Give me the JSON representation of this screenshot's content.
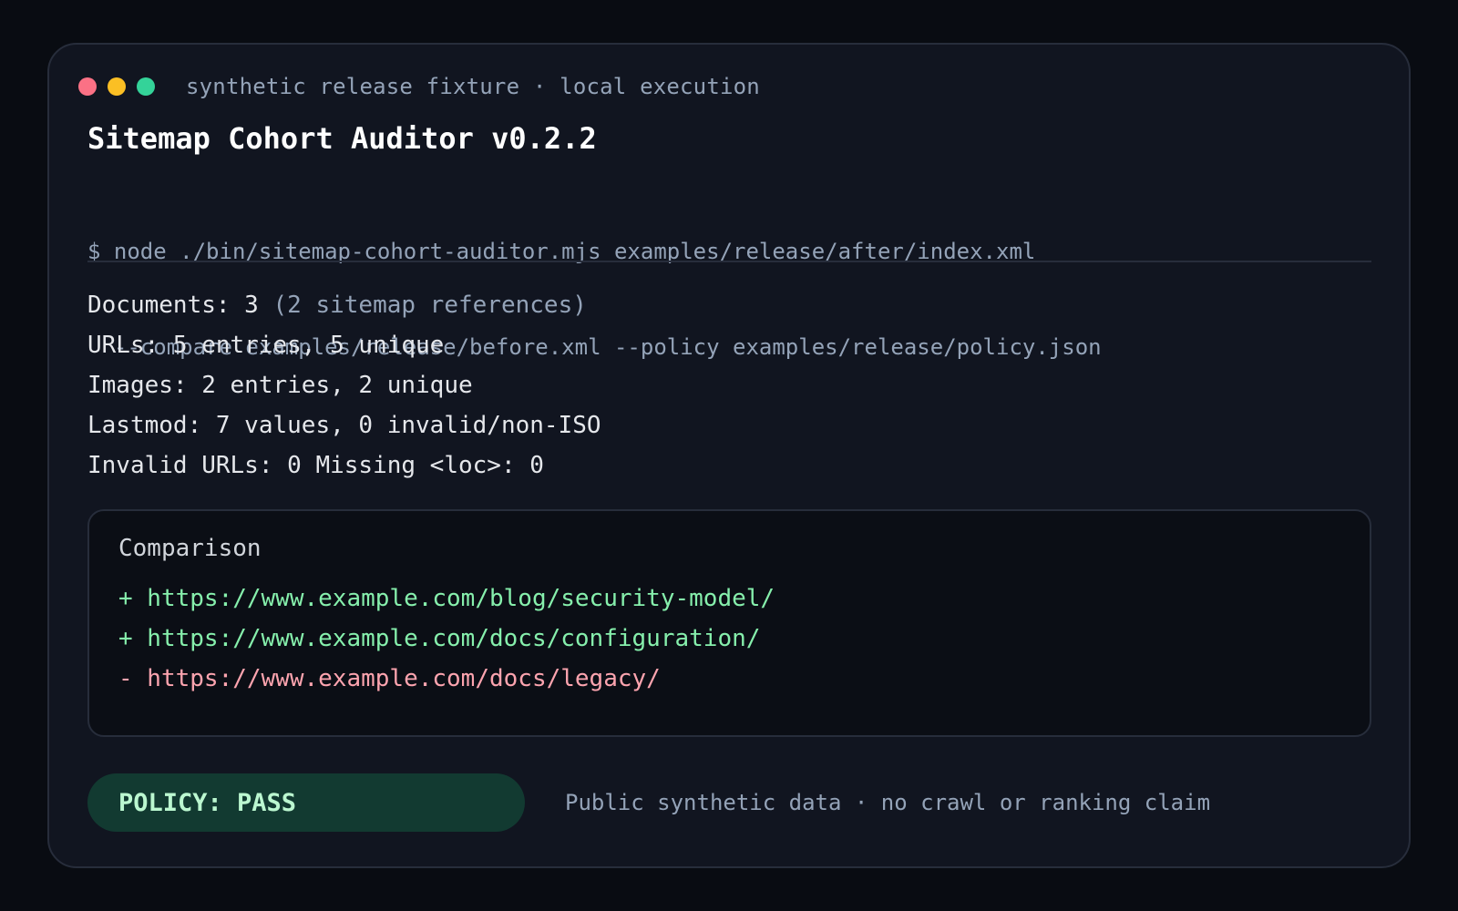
{
  "window": {
    "subtitle": "synthetic release fixture · local execution",
    "title": "Sitemap Cohort Auditor v0.2.2",
    "command_lines": [
      "$ node ./bin/sitemap-cohort-auditor.mjs examples/release/after/index.xml",
      "  --compare examples/release/before.xml --policy examples/release/policy.json"
    ]
  },
  "stats": {
    "documents": "Documents: 3",
    "documents_note": "(2 sitemap references)",
    "urls": "URLs: 5 entries, 5 unique",
    "images": "Images: 2 entries, 2 unique",
    "lastmod": "Lastmod: 7 values, 0 invalid/non-ISO",
    "invalid": "Invalid URLs: 0 Missing <loc>: 0"
  },
  "comparison": {
    "heading": "Comparison",
    "lines": [
      "+ https://www.example.com/blog/security-model/",
      "+ https://www.example.com/docs/configuration/",
      "- https://www.example.com/docs/legacy/"
    ]
  },
  "footer": {
    "policy_label": "POLICY: PASS",
    "note": "Public synthetic data · no crawl or ranking claim"
  },
  "colors": {
    "background": "#090c12",
    "panel": "#111520",
    "border": "#272d3b",
    "muted_text": "#94a3b8",
    "added": "#86efac",
    "removed": "#fda4af",
    "pass_badge": "#123a31",
    "pass_text": "#bbf7d0",
    "dot_red": "#fb7185",
    "dot_yellow": "#fbbf24",
    "dot_green": "#34d399"
  }
}
